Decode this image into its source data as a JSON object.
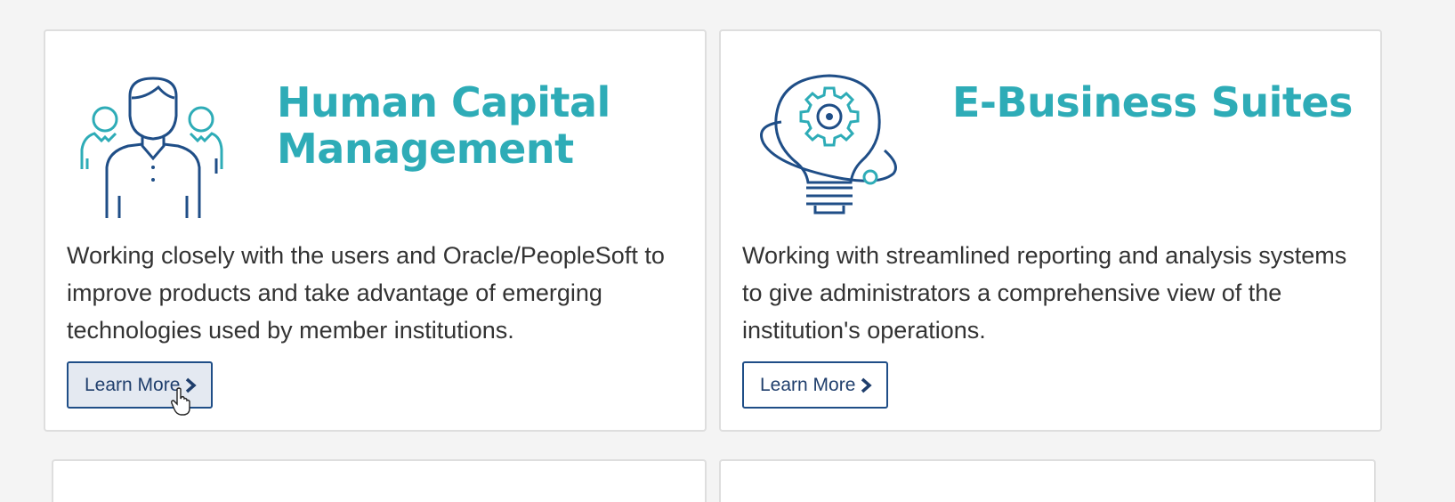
{
  "cards": [
    {
      "title_line1": "Human Capital",
      "title_line2": "Management",
      "description": "Working closely with the users and Oracle/PeopleSoft to improve products and take advantage of emerging technologies used by member institutions.",
      "button_label": "Learn More",
      "icon": "people-group-icon"
    },
    {
      "title_line1": "E-Business Suites",
      "title_line2": "",
      "description": "Working with streamlined reporting and analysis systems to give administrators a comprehensive view of the institution's operations.",
      "button_label": "Learn More",
      "icon": "lightbulb-gear-icon"
    }
  ],
  "colors": {
    "accent_teal": "#2eacb7",
    "navy": "#1f4e87",
    "text": "#333333"
  }
}
